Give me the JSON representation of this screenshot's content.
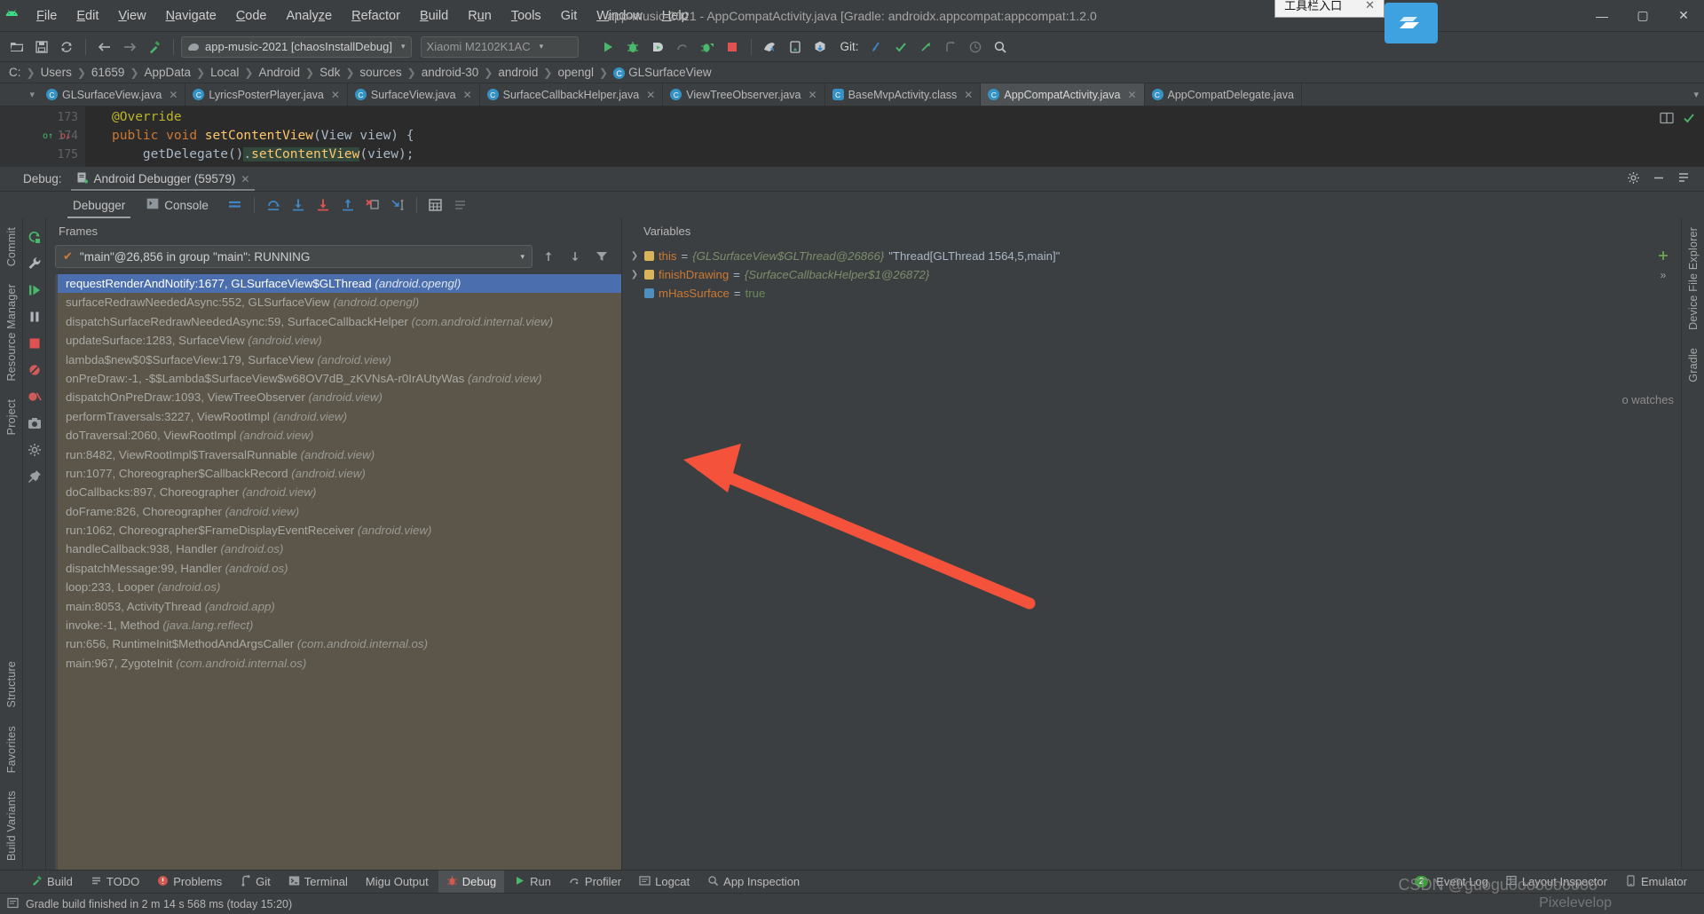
{
  "window": {
    "title": "app-music-2021 - AppCompatActivity.java [Gradle: androidx.appcompat:appcompat:1.2.0",
    "minimize": "—",
    "maximize": "▢",
    "close": "✕"
  },
  "tooltip": {
    "text": "工具栏入口",
    "close": "✕"
  },
  "menu": {
    "items": [
      {
        "label": "File"
      },
      {
        "label": "Edit"
      },
      {
        "label": "View"
      },
      {
        "label": "Navigate"
      },
      {
        "label": "Code"
      },
      {
        "label": "Analyze"
      },
      {
        "label": "Refactor"
      },
      {
        "label": "Build"
      },
      {
        "label": "Run"
      },
      {
        "label": "Tools"
      },
      {
        "label": "Git"
      },
      {
        "label": "Window"
      },
      {
        "label": "Help"
      }
    ]
  },
  "toolbar": {
    "open_icon": "folder-open-icon",
    "save_icon": "save-icon",
    "sync_icon": "sync-icon",
    "back_icon": "back-arrow-icon",
    "forward_icon": "forward-arrow-icon",
    "build_icon": "hammer-icon",
    "run_config": "app-music-2021 [chaosInstallDebug]",
    "device": "Xiaomi M2102K1AC",
    "git_label": "Git:",
    "caret": "▾"
  },
  "breadcrumb": {
    "items": [
      "C:",
      "Users",
      "61659",
      "AppData",
      "Local",
      "Android",
      "Sdk",
      "sources",
      "android-30",
      "android",
      "opengl",
      "GLSurfaceView"
    ],
    "separator": "❯",
    "last_icon_letter": "C"
  },
  "editor_tabs": {
    "tabs": [
      {
        "label": "GLSurfaceView.java",
        "kind": "class",
        "active": false
      },
      {
        "label": "LyricsPosterPlayer.java",
        "kind": "class",
        "active": false
      },
      {
        "label": "SurfaceView.java",
        "kind": "class",
        "active": false
      },
      {
        "label": "SurfaceCallbackHelper.java",
        "kind": "class",
        "active": false
      },
      {
        "label": "ViewTreeObserver.java",
        "kind": "class",
        "active": false
      },
      {
        "label": "BaseMvpActivity.class",
        "kind": "classfile",
        "active": false
      },
      {
        "label": "AppCompatActivity.java",
        "kind": "class",
        "active": true
      },
      {
        "label": "AppCompatDelegate.java",
        "kind": "class",
        "active": false
      }
    ],
    "close_glyph": "✕",
    "overflow_glyph": "▾"
  },
  "editor": {
    "lines": [
      {
        "num": "173",
        "text": "@Override",
        "kind": "annotation"
      },
      {
        "num": "174",
        "text": "public void setContentView(View view) {",
        "kind": "signature"
      },
      {
        "num": "175",
        "text": "getDelegate().setContentView(view);",
        "kind": "body"
      }
    ],
    "fold_glyph": "⊟",
    "marker_up": "o↑",
    "marker_down": "o↓"
  },
  "debug_header": {
    "label": "Debug:",
    "session": "Android Debugger (59579)",
    "close_glyph": "✕",
    "settings_icon": "gear-icon",
    "minimize_icon": "minimize-icon",
    "hide_icon": "hide-icon"
  },
  "debug_toolbar": {
    "tabs": [
      {
        "label": "Debugger",
        "selected": true
      },
      {
        "label": "Console",
        "selected": false
      }
    ],
    "buttons": [
      {
        "name": "show-execution-point-icon"
      },
      {
        "name": "step-over-icon"
      },
      {
        "name": "step-into-icon"
      },
      {
        "name": "force-step-into-icon"
      },
      {
        "name": "step-out-icon"
      },
      {
        "name": "drop-frame-icon"
      },
      {
        "name": "run-to-cursor-icon"
      },
      {
        "name": "evaluate-expression-icon"
      },
      {
        "name": "settings-list-icon"
      }
    ]
  },
  "left_rail": {
    "buttons": [
      {
        "name": "rerun-icon"
      },
      {
        "name": "wrench-icon"
      },
      {
        "name": "resume-icon"
      },
      {
        "name": "pause-icon"
      },
      {
        "name": "stop-icon"
      },
      {
        "name": "mute-breakpoints-icon"
      },
      {
        "name": "view-breakpoints-icon"
      },
      {
        "name": "camera-icon"
      },
      {
        "name": "settings-icon"
      },
      {
        "name": "pin-icon"
      }
    ]
  },
  "side_labels": {
    "left": [
      "Commit",
      "Resource Manager",
      "Project",
      "Structure",
      "Favorites",
      "Build Variants"
    ],
    "right": [
      "Device File Explorer",
      "Gradle"
    ]
  },
  "frames_panel": {
    "title": "Frames",
    "thread": "\"main\"@26,856 in group \"main\": RUNNING",
    "thread_check": "✔",
    "caret": "▾",
    "up_icon": "arrow-up-icon",
    "down_icon": "arrow-down-icon",
    "filter_icon": "filter-icon",
    "frames": [
      {
        "method": "requestRenderAndNotify:1677, GLSurfaceView$GLThread",
        "pkg": "(android.opengl)",
        "selected": true
      },
      {
        "method": "surfaceRedrawNeededAsync:552, GLSurfaceView",
        "pkg": "(android.opengl)",
        "selected": false
      },
      {
        "method": "dispatchSurfaceRedrawNeededAsync:59, SurfaceCallbackHelper",
        "pkg": "(com.android.internal.view)",
        "selected": false
      },
      {
        "method": "updateSurface:1283, SurfaceView",
        "pkg": "(android.view)",
        "selected": false
      },
      {
        "method": "lambda$new$0$SurfaceView:179, SurfaceView",
        "pkg": "(android.view)",
        "selected": false
      },
      {
        "method": "onPreDraw:-1, -$$Lambda$SurfaceView$w68OV7dB_zKVNsA-r0IrAUtyWas",
        "pkg": "(android.view)",
        "selected": false
      },
      {
        "method": "dispatchOnPreDraw:1093, ViewTreeObserver",
        "pkg": "(android.view)",
        "selected": false
      },
      {
        "method": "performTraversals:3227, ViewRootImpl",
        "pkg": "(android.view)",
        "selected": false
      },
      {
        "method": "doTraversal:2060, ViewRootImpl",
        "pkg": "(android.view)",
        "selected": false
      },
      {
        "method": "run:8482, ViewRootImpl$TraversalRunnable",
        "pkg": "(android.view)",
        "selected": false
      },
      {
        "method": "run:1077, Choreographer$CallbackRecord",
        "pkg": "(android.view)",
        "selected": false
      },
      {
        "method": "doCallbacks:897, Choreographer",
        "pkg": "(android.view)",
        "selected": false
      },
      {
        "method": "doFrame:826, Choreographer",
        "pkg": "(android.view)",
        "selected": false
      },
      {
        "method": "run:1062, Choreographer$FrameDisplayEventReceiver",
        "pkg": "(android.view)",
        "selected": false
      },
      {
        "method": "handleCallback:938, Handler",
        "pkg": "(android.os)",
        "selected": false
      },
      {
        "method": "dispatchMessage:99, Handler",
        "pkg": "(android.os)",
        "selected": false
      },
      {
        "method": "loop:233, Looper",
        "pkg": "(android.os)",
        "selected": false
      },
      {
        "method": "main:8053, ActivityThread",
        "pkg": "(android.app)",
        "selected": false
      },
      {
        "method": "invoke:-1, Method",
        "pkg": "(java.lang.reflect)",
        "selected": false
      },
      {
        "method": "run:656, RuntimeInit$MethodAndArgsCaller",
        "pkg": "(com.android.internal.os)",
        "selected": false
      },
      {
        "method": "main:967, ZygoteInit",
        "pkg": "(com.android.internal.os)",
        "selected": false
      }
    ]
  },
  "variables_panel": {
    "title": "Variables",
    "watches_label": "o watches",
    "add_icon": "plus-icon",
    "more_icon": "chevrons-icon",
    "vars": [
      {
        "arrow": "❯",
        "name": "this",
        "eq": "=",
        "value": "{GLSurfaceView$GLThread@26866}",
        "extra": "\"Thread[GLThread 1564,5,main]\"",
        "icon": "object-field-icon"
      },
      {
        "arrow": "❯",
        "name": "finishDrawing",
        "eq": "=",
        "value": "{SurfaceCallbackHelper$1@26872}",
        "extra": "",
        "icon": "object-field-icon"
      },
      {
        "arrow": "",
        "name": "mHasSurface",
        "eq": "=",
        "value": "true",
        "extra": "",
        "icon": "primitive-field-icon"
      }
    ]
  },
  "bottom_tools": {
    "items": [
      {
        "label": "Build",
        "icon": "build-icon",
        "active": false
      },
      {
        "label": "TODO",
        "icon": "todo-icon",
        "active": false
      },
      {
        "label": "Problems",
        "icon": "problems-icon",
        "active": false
      },
      {
        "label": "Git",
        "icon": "git-icon",
        "active": false
      },
      {
        "label": "Terminal",
        "icon": "terminal-icon",
        "active": false
      },
      {
        "label": "Migu Output",
        "icon": "output-icon",
        "active": false
      },
      {
        "label": "Debug",
        "icon": "debug-icon",
        "active": true
      },
      {
        "label": "Run",
        "icon": "run-icon",
        "active": false
      },
      {
        "label": "Profiler",
        "icon": "profiler-icon",
        "active": false
      },
      {
        "label": "Logcat",
        "icon": "logcat-icon",
        "active": false
      },
      {
        "label": "App Inspection",
        "icon": "inspection-icon",
        "active": false
      }
    ],
    "right": [
      {
        "label": "Event Log",
        "icon": "event-log-icon",
        "badge": "2"
      },
      {
        "label": "Layout Inspector",
        "icon": "layout-inspector-icon",
        "badge": ""
      },
      {
        "label": "Emulator",
        "icon": "emulator-icon",
        "badge": ""
      }
    ]
  },
  "statusbar": {
    "message": "Gradle build finished in 2 m 14 s 568 ms (today 15:20)",
    "icon": "info-icon"
  },
  "watermark": {
    "text": "CSDN @guoguoooooooooo",
    "secondary": "Pixelevelop"
  }
}
